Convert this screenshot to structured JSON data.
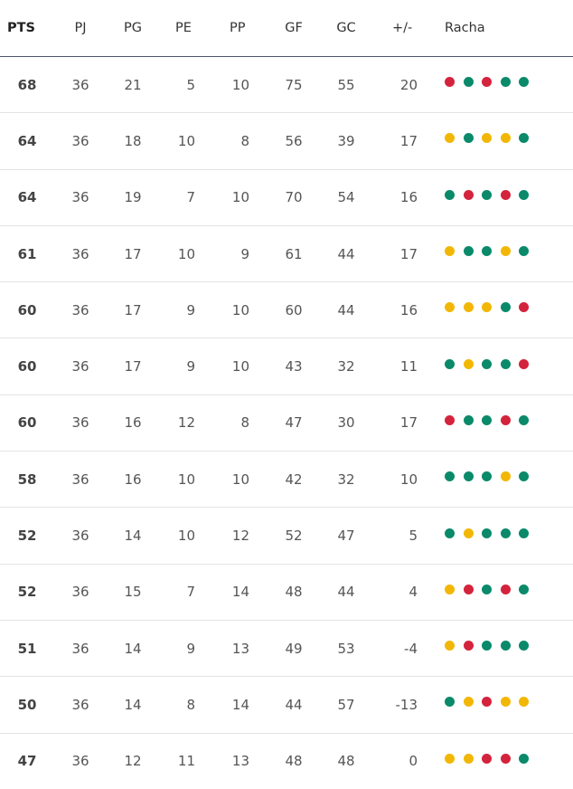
{
  "colors": {
    "W": "#0a8a6a",
    "D": "#f2b705",
    "L": "#d4233c"
  },
  "header": {
    "pts": "PTS",
    "pj": "PJ",
    "pg": "PG",
    "pe": "PE",
    "pp": "PP",
    "gf": "GF",
    "gc": "GC",
    "diff": "+/-",
    "racha": "Racha"
  },
  "rows": [
    {
      "pts": "68",
      "pj": "36",
      "pg": "21",
      "pe": "5",
      "pp": "10",
      "gf": "75",
      "gc": "55",
      "diff": "20",
      "racha": [
        "L",
        "W",
        "L",
        "W",
        "W"
      ]
    },
    {
      "pts": "64",
      "pj": "36",
      "pg": "18",
      "pe": "10",
      "pp": "8",
      "gf": "56",
      "gc": "39",
      "diff": "17",
      "racha": [
        "D",
        "W",
        "D",
        "D",
        "W"
      ]
    },
    {
      "pts": "64",
      "pj": "36",
      "pg": "19",
      "pe": "7",
      "pp": "10",
      "gf": "70",
      "gc": "54",
      "diff": "16",
      "racha": [
        "W",
        "L",
        "W",
        "L",
        "W"
      ]
    },
    {
      "pts": "61",
      "pj": "36",
      "pg": "17",
      "pe": "10",
      "pp": "9",
      "gf": "61",
      "gc": "44",
      "diff": "17",
      "racha": [
        "D",
        "W",
        "W",
        "D",
        "W"
      ]
    },
    {
      "pts": "60",
      "pj": "36",
      "pg": "17",
      "pe": "9",
      "pp": "10",
      "gf": "60",
      "gc": "44",
      "diff": "16",
      "racha": [
        "D",
        "D",
        "D",
        "W",
        "L"
      ]
    },
    {
      "pts": "60",
      "pj": "36",
      "pg": "17",
      "pe": "9",
      "pp": "10",
      "gf": "43",
      "gc": "32",
      "diff": "11",
      "racha": [
        "W",
        "D",
        "W",
        "W",
        "L"
      ]
    },
    {
      "pts": "60",
      "pj": "36",
      "pg": "16",
      "pe": "12",
      "pp": "8",
      "gf": "47",
      "gc": "30",
      "diff": "17",
      "racha": [
        "L",
        "W",
        "W",
        "L",
        "W"
      ]
    },
    {
      "pts": "58",
      "pj": "36",
      "pg": "16",
      "pe": "10",
      "pp": "10",
      "gf": "42",
      "gc": "32",
      "diff": "10",
      "racha": [
        "W",
        "W",
        "W",
        "D",
        "W"
      ]
    },
    {
      "pts": "52",
      "pj": "36",
      "pg": "14",
      "pe": "10",
      "pp": "12",
      "gf": "52",
      "gc": "47",
      "diff": "5",
      "racha": [
        "W",
        "D",
        "W",
        "W",
        "W"
      ]
    },
    {
      "pts": "52",
      "pj": "36",
      "pg": "15",
      "pe": "7",
      "pp": "14",
      "gf": "48",
      "gc": "44",
      "diff": "4",
      "racha": [
        "D",
        "L",
        "W",
        "L",
        "W"
      ]
    },
    {
      "pts": "51",
      "pj": "36",
      "pg": "14",
      "pe": "9",
      "pp": "13",
      "gf": "49",
      "gc": "53",
      "diff": "-4",
      "racha": [
        "D",
        "L",
        "W",
        "W",
        "W"
      ]
    },
    {
      "pts": "50",
      "pj": "36",
      "pg": "14",
      "pe": "8",
      "pp": "14",
      "gf": "44",
      "gc": "57",
      "diff": "-13",
      "racha": [
        "W",
        "D",
        "L",
        "D",
        "D"
      ]
    },
    {
      "pts": "47",
      "pj": "36",
      "pg": "12",
      "pe": "11",
      "pp": "13",
      "gf": "48",
      "gc": "48",
      "diff": "0",
      "racha": [
        "D",
        "D",
        "L",
        "L",
        "W"
      ]
    }
  ]
}
